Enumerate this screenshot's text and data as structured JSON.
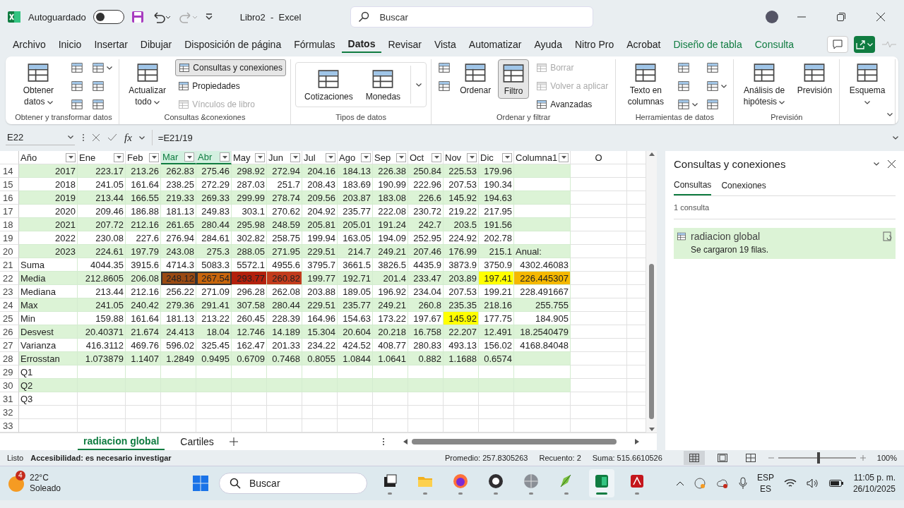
{
  "title_bar": {
    "autosave": {
      "label": "Autoguardado",
      "on": false
    },
    "title": "Libro2  -  Excel",
    "search": {
      "placeholder": "Buscar"
    }
  },
  "menu": [
    {
      "label": "Archivo",
      "selected": false,
      "kind": "normal"
    },
    {
      "label": "Inicio",
      "selected": false,
      "kind": "normal"
    },
    {
      "label": "Insertar",
      "selected": false,
      "kind": "normal"
    },
    {
      "label": "Dibujar",
      "selected": false,
      "kind": "normal"
    },
    {
      "label": "Disposición de página",
      "selected": false,
      "kind": "normal"
    },
    {
      "label": "Fórmulas",
      "selected": false,
      "kind": "normal"
    },
    {
      "label": "Datos",
      "selected": true,
      "kind": "normal"
    },
    {
      "label": "Revisar",
      "selected": false,
      "kind": "normal"
    },
    {
      "label": "Vista",
      "selected": false,
      "kind": "normal"
    },
    {
      "label": "Automatizar",
      "selected": false,
      "kind": "normal"
    },
    {
      "label": "Ayuda",
      "selected": false,
      "kind": "normal"
    },
    {
      "label": "Nitro Pro",
      "selected": false,
      "kind": "normal"
    },
    {
      "label": "Acrobat",
      "selected": false,
      "kind": "normal"
    },
    {
      "label": "Diseño de tabla",
      "selected": false,
      "kind": "contextual"
    },
    {
      "label": "Consulta",
      "selected": false,
      "kind": "contextual"
    }
  ],
  "ribbon": [
    {
      "label": "Obtener y transformar datos",
      "columns": [
        [
          {
            "kind": "large",
            "label": "Obtener datos",
            "dropdown": true,
            "disabled": false,
            "pressed": false
          }
        ],
        [
          {
            "kind": "icon",
            "dropdown": false
          },
          {
            "kind": "icon",
            "dropdown": false
          },
          {
            "kind": "icon",
            "dropdown": false
          }
        ],
        [
          {
            "kind": "icon",
            "dropdown": true
          },
          {
            "kind": "icon",
            "dropdown": false
          },
          {
            "kind": "icon",
            "dropdown": false
          }
        ]
      ]
    },
    {
      "label": "Consultas &conexiones",
      "columns": [
        [
          {
            "kind": "large",
            "label": "Actualizar todo",
            "dropdown": true,
            "disabled": false,
            "pressed": false
          }
        ],
        [
          {
            "kind": "small",
            "label": "Consultas y conexiones",
            "dropdown": false,
            "disabled": false,
            "pressed": true
          },
          {
            "kind": "small",
            "label": "Propiedades",
            "dropdown": false,
            "disabled": false,
            "pressed": false
          },
          {
            "kind": "small",
            "label": "Vínculos de libro",
            "dropdown": false,
            "disabled": true,
            "pressed": false
          }
        ]
      ]
    },
    {
      "label": "Tipos de datos",
      "gallery": true,
      "columns": [
        [
          {
            "kind": "large",
            "label": "Cotizaciones",
            "dropdown": false,
            "disabled": false,
            "pressed": false
          }
        ],
        [
          {
            "kind": "large",
            "label": "Monedas",
            "dropdown": false,
            "disabled": false,
            "pressed": false
          }
        ]
      ]
    },
    {
      "label": "Ordenar y filtrar",
      "columns": [
        [
          {
            "kind": "icon",
            "dropdown": false
          },
          {
            "kind": "icon",
            "dropdown": false
          }
        ],
        [
          {
            "kind": "large",
            "label": "Ordenar",
            "dropdown": false,
            "disabled": false,
            "pressed": false
          }
        ],
        [
          {
            "kind": "large",
            "label": "Filtro",
            "dropdown": false,
            "disabled": false,
            "pressed": true
          }
        ],
        [
          {
            "kind": "small",
            "label": "Borrar",
            "dropdown": false,
            "disabled": true,
            "pressed": false
          },
          {
            "kind": "small",
            "label": "Volver a aplicar",
            "dropdown": false,
            "disabled": true,
            "pressed": false
          },
          {
            "kind": "small",
            "label": "Avanzadas",
            "dropdown": false,
            "disabled": false,
            "pressed": false
          }
        ]
      ]
    },
    {
      "label": "Herramientas de datos",
      "columns": [
        [
          {
            "kind": "large",
            "label": "Texto en columnas",
            "dropdown": false,
            "disabled": false,
            "pressed": false
          }
        ],
        [
          {
            "kind": "icon",
            "dropdown": false
          },
          {
            "kind": "icon",
            "dropdown": false
          },
          {
            "kind": "icon",
            "dropdown": true
          }
        ],
        [
          {
            "kind": "icon",
            "dropdown": false
          },
          {
            "kind": "icon",
            "dropdown": true
          },
          {
            "kind": "icon",
            "dropdown": false
          }
        ]
      ]
    },
    {
      "label": "Previsión",
      "columns": [
        [
          {
            "kind": "large",
            "label": "Análisis de hipótesis",
            "dropdown": true,
            "disabled": false,
            "pressed": false
          }
        ],
        [
          {
            "kind": "large",
            "label": "Previsión",
            "dropdown": false,
            "disabled": false,
            "pressed": false
          }
        ]
      ]
    },
    {
      "columns": [
        [
          {
            "kind": "large",
            "label": "Esquema",
            "dropdown": true,
            "disabled": false,
            "pressed": false
          }
        ]
      ]
    }
  ],
  "formula_bar": {
    "name_box": "E22",
    "function_label": "fx",
    "formula": "=E21/19"
  },
  "sheet": {
    "columns": [
      {
        "label": "Año",
        "kind": "filter",
        "selected": false
      },
      {
        "label": "Ene",
        "kind": "filter",
        "selected": false
      },
      {
        "label": "Feb",
        "kind": "filter",
        "selected": false
      },
      {
        "label": "Mar",
        "kind": "filter",
        "selected": true
      },
      {
        "label": "Abr",
        "kind": "filter",
        "selected": true
      },
      {
        "label": "May",
        "kind": "filter",
        "selected": false
      },
      {
        "label": "Jun",
        "kind": "filter",
        "selected": false
      },
      {
        "label": "Jul",
        "kind": "filter",
        "selected": false
      },
      {
        "label": "Ago",
        "kind": "filter",
        "selected": false
      },
      {
        "label": "Sep",
        "kind": "filter",
        "selected": false
      },
      {
        "label": "Oct",
        "kind": "filter",
        "selected": false
      },
      {
        "label": "Nov",
        "kind": "filter",
        "selected": false
      },
      {
        "label": "Dic",
        "kind": "filter",
        "selected": false
      },
      {
        "label": "Columna1",
        "kind": "filter",
        "selected": false
      },
      {
        "label": "O",
        "kind": "letter",
        "selected": false
      }
    ],
    "rows": [
      {
        "num": "14",
        "kind": "year",
        "cells": [
          "2017",
          "223.17",
          "213.26",
          "262.83",
          "275.46",
          "298.92",
          "272.94",
          "204.16",
          "184.13",
          "226.38",
          "250.84",
          "225.53",
          "179.96"
        ]
      },
      {
        "num": "15",
        "kind": "year",
        "cells": [
          "2018",
          "241.05",
          "161.64",
          "238.25",
          "272.29",
          "287.03",
          "251.7",
          "208.43",
          "183.69",
          "190.99",
          "222.96",
          "207.53",
          "190.34"
        ]
      },
      {
        "num": "16",
        "kind": "year",
        "cells": [
          "2019",
          "213.44",
          "166.55",
          "219.33",
          "269.33",
          "299.99",
          "278.74",
          "209.56",
          "203.87",
          "183.08",
          "226.6",
          "145.92",
          "194.63"
        ]
      },
      {
        "num": "17",
        "kind": "year",
        "cells": [
          "2020",
          "209.46",
          "186.88",
          "181.13",
          "249.83",
          "303.1",
          "270.62",
          "204.92",
          "235.77",
          "222.08",
          "230.72",
          "219.22",
          "217.95"
        ]
      },
      {
        "num": "18",
        "kind": "year",
        "cells": [
          "2021",
          "207.72",
          "212.16",
          "261.65",
          "280.44",
          "295.98",
          "248.59",
          "205.81",
          "205.01",
          "191.24",
          "242.7",
          "203.5",
          "191.56"
        ]
      },
      {
        "num": "19",
        "kind": "year",
        "cells": [
          "2022",
          "230.08",
          "227.6",
          "276.94",
          "284.61",
          "302.82",
          "258.75",
          "199.94",
          "163.05",
          "194.09",
          "252.95",
          "224.92",
          "202.78"
        ]
      },
      {
        "num": "20",
        "kind": "year",
        "cells": [
          "2023",
          "224.61",
          "197.79",
          "243.08",
          "275.3",
          "288.05",
          "271.95",
          "229.51",
          "214.7",
          "249.21",
          "207.46",
          "176.99",
          "215.1",
          {
            "text": "Anual:",
            "kind": "label"
          }
        ]
      },
      {
        "num": "21",
        "kind": "stat",
        "cells": [
          "Suma",
          "4044.35",
          "3915.6",
          "4714.3",
          "5083.3",
          "5572.1",
          "4955.6",
          "3795.7",
          "3661.5",
          "3826.5",
          "4435.9",
          "3873.9",
          "3750.9",
          "4302.46083"
        ]
      },
      {
        "num": "22",
        "kind": "stat",
        "cells": [
          "Media",
          "212.8605",
          "206.08",
          {
            "text": "248.12",
            "color": "#9a4a12",
            "selected": true
          },
          {
            "text": "267.54",
            "color": "#c8660c",
            "selected": true
          },
          {
            "text": "293.77",
            "color": "#b3200c",
            "selected": false
          },
          {
            "text": "260.82",
            "color": "#c23b1c",
            "selected": false
          },
          "199.77",
          "192.71",
          "201.4",
          "233.47",
          "203.89",
          {
            "text": "197.41",
            "color": "#ffff00",
            "selected": false
          },
          {
            "text": "226.445307",
            "color": "#f5b800",
            "selected": false
          }
        ]
      },
      {
        "num": "23",
        "kind": "stat",
        "cells": [
          "Mediana",
          "213.44",
          "212.16",
          "256.22",
          "271.09",
          "296.28",
          "262.08",
          "203.88",
          "189.05",
          "196.92",
          "234.04",
          "207.53",
          "199.21",
          "228.491667"
        ]
      },
      {
        "num": "24",
        "kind": "stat",
        "cells": [
          "Max",
          "241.05",
          "240.42",
          "279.36",
          "291.41",
          "307.58",
          "280.44",
          "229.51",
          "235.77",
          "249.21",
          "260.8",
          "235.35",
          "218.16",
          "255.755"
        ]
      },
      {
        "num": "25",
        "kind": "stat",
        "cells": [
          "Min",
          "159.88",
          "161.64",
          "181.13",
          "213.22",
          "260.45",
          "228.39",
          "164.96",
          "154.63",
          "173.22",
          "197.67",
          {
            "text": "145.92",
            "color": "#ffff00",
            "selected": false
          },
          "177.75",
          "184.905"
        ]
      },
      {
        "num": "26",
        "kind": "stat",
        "cells": [
          "Desvest",
          "20.40371",
          "21.674",
          "24.413",
          "18.04",
          "12.746",
          "14.189",
          "15.304",
          "20.604",
          "20.218",
          "16.758",
          "22.207",
          "12.491",
          "18.2540479"
        ]
      },
      {
        "num": "27",
        "kind": "stat",
        "cells": [
          "Varianza",
          "416.3112",
          "469.76",
          "596.02",
          "325.45",
          "162.47",
          "201.33",
          "234.22",
          "424.52",
          "408.77",
          "280.83",
          "493.13",
          "156.02",
          "4168.84048"
        ]
      },
      {
        "num": "28",
        "kind": "stat",
        "cells": [
          "Errosstan",
          "1.073879",
          "1.1407",
          "1.2849",
          "0.9495",
          "0.6709",
          "0.7468",
          "0.8055",
          "1.0844",
          "1.0641",
          "0.882",
          "1.1688",
          "0.6574"
        ]
      },
      {
        "num": "29",
        "kind": "stat",
        "cells": [
          "Q1"
        ]
      },
      {
        "num": "30",
        "kind": "stat",
        "cells": [
          "Q2"
        ]
      },
      {
        "num": "31",
        "kind": "outside",
        "cells": [
          "Q3"
        ]
      },
      {
        "num": "32",
        "kind": "outside",
        "cells": []
      },
      {
        "num": "33",
        "kind": "outside",
        "cells": []
      }
    ],
    "tabs": [
      {
        "label": "radiacion global",
        "selected": true
      },
      {
        "label": "Cartiles",
        "selected": false
      }
    ]
  },
  "panel": {
    "title": "Consultas y conexiones",
    "tabs": [
      {
        "label": "Consultas",
        "selected": true
      },
      {
        "label": "Conexiones",
        "selected": false
      }
    ],
    "count": "1 consulta",
    "queries": [
      {
        "name": "radiacion global",
        "status": "Se cargaron 19 filas.",
        "selected": true
      }
    ]
  },
  "status_bar": {
    "mode": "Listo",
    "accessibility": "Accesibilidad: es necesario investigar",
    "stats": [
      "Promedio: 257.8305263",
      "Recuento: 2",
      "Suma: 515.6610526"
    ],
    "views": [
      {
        "selected": true
      },
      {
        "selected": false
      },
      {
        "selected": false
      }
    ],
    "zoom": {
      "level": 0.5,
      "label": "100%"
    }
  },
  "taskbar": {
    "weather": {
      "badge": "4",
      "temperature": "22°C",
      "condition": "Soleado"
    },
    "search": {
      "placeholder": "Buscar"
    },
    "apps": [
      {
        "selected": false
      },
      {
        "selected": false
      },
      {
        "selected": false
      },
      {
        "selected": false
      },
      {
        "selected": false
      },
      {
        "selected": false
      },
      {
        "selected": true
      },
      {
        "selected": false
      }
    ],
    "language": [
      "ESP",
      "ES"
    ],
    "time": "11:05 p. m.",
    "date": "26/10/2025"
  }
}
